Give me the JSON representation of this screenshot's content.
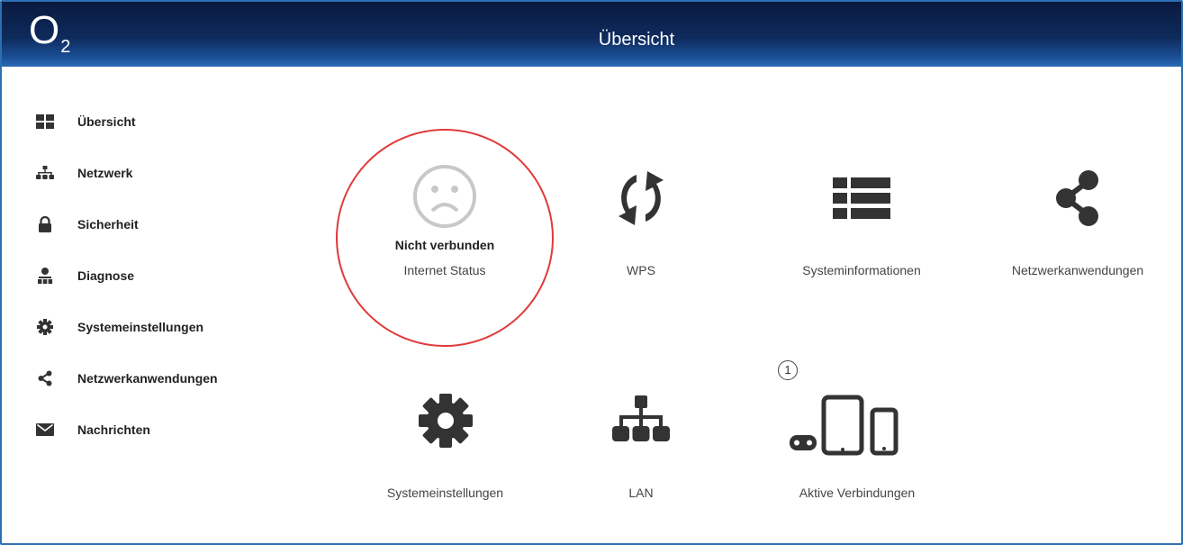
{
  "header": {
    "logo": "O",
    "logo_sub": "2",
    "title": "Übersicht"
  },
  "sidebar": {
    "items": [
      {
        "label": "Übersicht",
        "icon": "grid-icon"
      },
      {
        "label": "Netzwerk",
        "icon": "network-icon"
      },
      {
        "label": "Sicherheit",
        "icon": "lock-icon"
      },
      {
        "label": "Diagnose",
        "icon": "diagnose-icon"
      },
      {
        "label": "Systemeinstellungen",
        "icon": "gear-icon"
      },
      {
        "label": "Netzwerkanwendungen",
        "icon": "share-icon"
      },
      {
        "label": "Nachrichten",
        "icon": "envelope-icon"
      }
    ]
  },
  "tiles": {
    "internet": {
      "status": "Nicht verbunden",
      "label": "Internet Status",
      "icon": "sad-face-icon"
    },
    "wps": {
      "label": "WPS",
      "icon": "wps-icon"
    },
    "sysinfo": {
      "label": "Systeminformationen",
      "icon": "list-icon"
    },
    "netapps": {
      "label": "Netzwerkanwendungen",
      "icon": "share-icon"
    },
    "syssettings": {
      "label": "Systemeinstellungen",
      "icon": "gear-icon"
    },
    "lan": {
      "label": "LAN",
      "icon": "network-icon"
    },
    "connections": {
      "label": "Aktive Verbindungen",
      "badge": "1",
      "icon": "devices-icon"
    }
  },
  "colors": {
    "header_dark": "#0a1a3f",
    "header_light": "#2a6ab8",
    "status_ring": "#e03a3a",
    "icon": "#333333"
  }
}
